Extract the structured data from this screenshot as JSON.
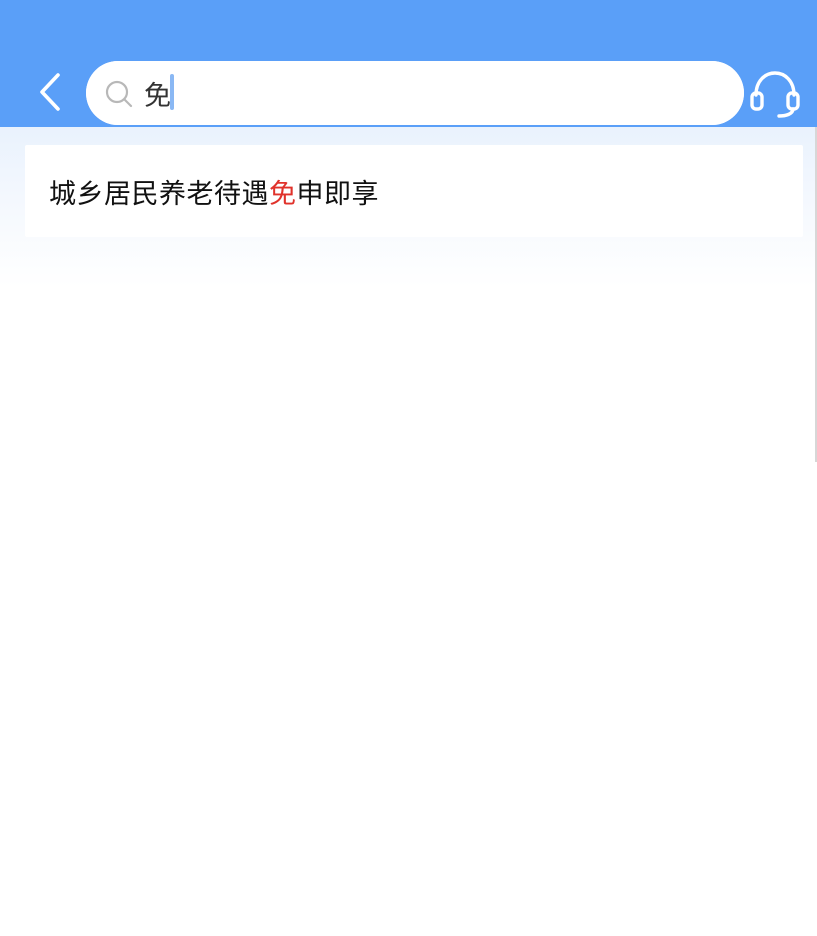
{
  "search": {
    "value": "免",
    "icon": "search-icon"
  },
  "header": {
    "back_icon": "chevron-left-icon",
    "support_icon": "headset-icon"
  },
  "results": [
    {
      "prefix": "城乡居民养老待遇",
      "match": "免",
      "suffix": "申即享"
    }
  ],
  "colors": {
    "header": "#5a9ff8",
    "highlight": "#e0322b"
  }
}
